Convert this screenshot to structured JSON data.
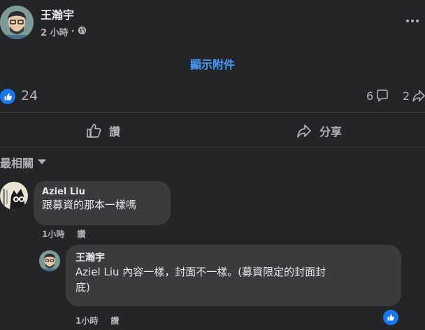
{
  "post": {
    "author": "王瀚宇",
    "time": "2 小時",
    "separator": "·",
    "privacy_icon": "globe-icon",
    "show_attachment": "顯示附件",
    "reaction_count": "24",
    "comment_count": "6",
    "share_count": "2"
  },
  "actions": {
    "like": "讚",
    "share": "分享"
  },
  "sort": {
    "label": "最相關"
  },
  "comments": [
    {
      "author": "Aziel Liu",
      "text": "跟募資的那本一樣嗎",
      "time": "1小時",
      "like": "讚"
    },
    {
      "author": "王瀚宇",
      "text_line1": "Aziel Liu 內容一樣，封面不一樣。(募資限定的封面封",
      "text_line2": "底)",
      "time": "1小時",
      "like": "讚"
    }
  ],
  "colors": {
    "background": "#242526",
    "bubble": "#3a3b3c",
    "link": "#4599ff",
    "like_blue": "#1877f2",
    "muted": "#b0b3b8"
  }
}
